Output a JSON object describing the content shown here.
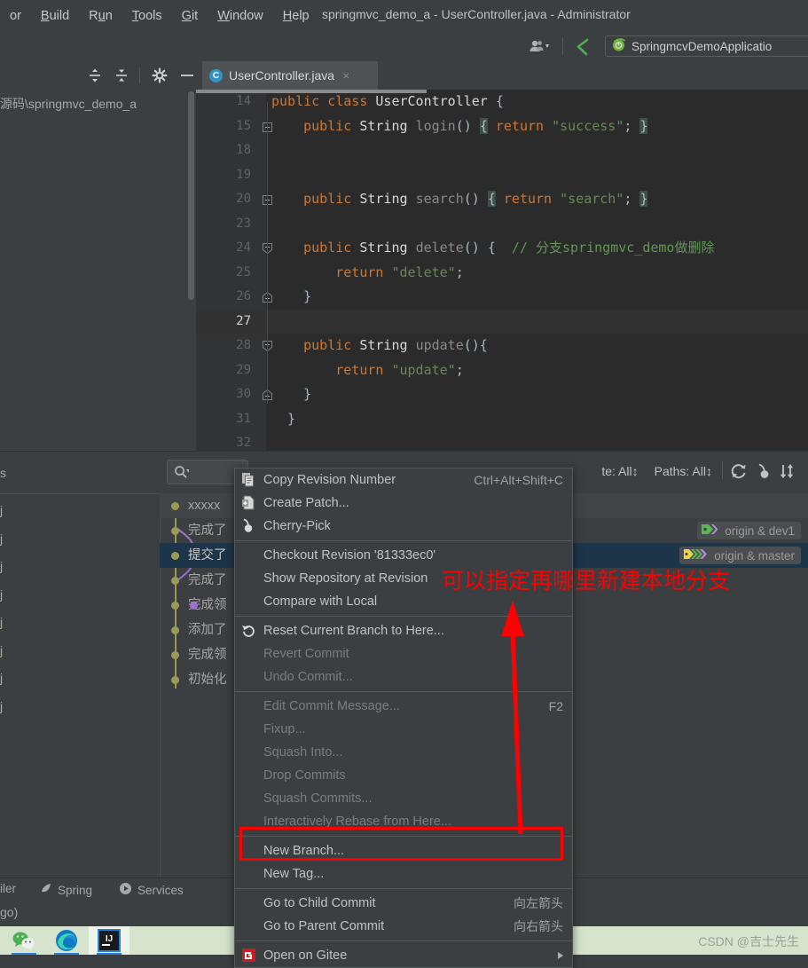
{
  "window": {
    "title": "springmvc_demo_a - UserController.java - Administrator"
  },
  "menubar": {
    "items": [
      {
        "label": "or",
        "mnemonic": ""
      },
      {
        "label": "Build",
        "mnemonic": "B"
      },
      {
        "label": "Run",
        "mnemonic": "u"
      },
      {
        "label": "Tools",
        "mnemonic": "T"
      },
      {
        "label": "Git",
        "mnemonic": "G"
      },
      {
        "label": "Window",
        "mnemonic": "W"
      },
      {
        "label": "Help",
        "mnemonic": "H"
      }
    ]
  },
  "toolbar": {
    "user_icon": "user-icon",
    "back_icon": "back-arrow-icon",
    "run_config": "SpringmcvDemoApplicatio",
    "run_config_icon": "spring-boot-icon"
  },
  "tabstrip": {
    "icons": [
      "expand-all-icon",
      "collapse-all-icon",
      "settings-gear-icon",
      "hide-icon"
    ],
    "tab": {
      "label": "UserController.java",
      "class_marker": "C",
      "close": "×"
    }
  },
  "project_panel": {
    "path": "源码\\springmvc_demo_a"
  },
  "editor": {
    "lines": [
      {
        "num": "14",
        "current": false,
        "fold": "none",
        "tokens": [
          {
            "t": "public ",
            "c": "k-kw"
          },
          {
            "t": "class ",
            "c": "k-kw"
          },
          {
            "t": "UserController ",
            "c": "k-type"
          },
          {
            "t": "{",
            "c": "k-pl"
          }
        ]
      },
      {
        "num": "15",
        "current": false,
        "fold": "plus",
        "tokens": [
          {
            "t": "    ",
            "c": "k-pl"
          },
          {
            "t": "public ",
            "c": "k-kw"
          },
          {
            "t": "String ",
            "c": "k-type"
          },
          {
            "t": "login",
            "c": "k-m"
          },
          {
            "t": "() ",
            "c": "k-pl"
          },
          {
            "t": "{",
            "c": "brmatch"
          },
          {
            "t": " ",
            "c": "k-pl"
          },
          {
            "t": "return ",
            "c": "k-kw"
          },
          {
            "t": "\"success\"",
            "c": "k-str"
          },
          {
            "t": "; ",
            "c": "k-pl"
          },
          {
            "t": "}",
            "c": "brmatch"
          }
        ]
      },
      {
        "num": "18",
        "current": false,
        "fold": "none",
        "tokens": []
      },
      {
        "num": "19",
        "current": false,
        "fold": "none",
        "tokens": []
      },
      {
        "num": "20",
        "current": false,
        "fold": "plus",
        "tokens": [
          {
            "t": "    ",
            "c": "k-pl"
          },
          {
            "t": "public ",
            "c": "k-kw"
          },
          {
            "t": "String ",
            "c": "k-type"
          },
          {
            "t": "search",
            "c": "k-m"
          },
          {
            "t": "() ",
            "c": "k-pl"
          },
          {
            "t": "{",
            "c": "brmatch"
          },
          {
            "t": " ",
            "c": "k-pl"
          },
          {
            "t": "return ",
            "c": "k-kw"
          },
          {
            "t": "\"search\"",
            "c": "k-str"
          },
          {
            "t": "; ",
            "c": "k-pl"
          },
          {
            "t": "}",
            "c": "brmatch"
          }
        ]
      },
      {
        "num": "23",
        "current": false,
        "fold": "none",
        "tokens": []
      },
      {
        "num": "24",
        "current": false,
        "fold": "open",
        "tokens": [
          {
            "t": "    ",
            "c": "k-pl"
          },
          {
            "t": "public ",
            "c": "k-kw"
          },
          {
            "t": "String ",
            "c": "k-type"
          },
          {
            "t": "delete",
            "c": "k-m"
          },
          {
            "t": "() { ",
            "c": "k-pl"
          },
          {
            "t": " // 分支springmvc_demo做删除",
            "c": "k-cm"
          }
        ]
      },
      {
        "num": "25",
        "current": false,
        "fold": "none",
        "tokens": [
          {
            "t": "        ",
            "c": "k-pl"
          },
          {
            "t": "return ",
            "c": "k-kw"
          },
          {
            "t": "\"delete\"",
            "c": "k-str"
          },
          {
            "t": ";",
            "c": "k-pl"
          }
        ]
      },
      {
        "num": "26",
        "current": false,
        "fold": "close",
        "tokens": [
          {
            "t": "    }",
            "c": "k-pl"
          }
        ]
      },
      {
        "num": "27",
        "current": true,
        "fold": "none",
        "tokens": []
      },
      {
        "num": "28",
        "current": false,
        "fold": "open",
        "tokens": [
          {
            "t": "    ",
            "c": "k-pl"
          },
          {
            "t": "public ",
            "c": "k-kw"
          },
          {
            "t": "String ",
            "c": "k-type"
          },
          {
            "t": "update",
            "c": "k-m"
          },
          {
            "t": "(){",
            "c": "k-pl"
          }
        ]
      },
      {
        "num": "29",
        "current": false,
        "fold": "none",
        "tokens": [
          {
            "t": "        ",
            "c": "k-pl"
          },
          {
            "t": "return ",
            "c": "k-kw"
          },
          {
            "t": "\"update\"",
            "c": "k-str"
          },
          {
            "t": ";",
            "c": "k-pl"
          }
        ]
      },
      {
        "num": "30",
        "current": false,
        "fold": "close",
        "tokens": [
          {
            "t": "    }",
            "c": "k-pl"
          }
        ]
      },
      {
        "num": "31",
        "current": false,
        "fold": "none",
        "tokens": [
          {
            "t": "  }",
            "c": "k-pl"
          }
        ]
      },
      {
        "num": "32",
        "current": false,
        "fold": "none",
        "tokens": []
      }
    ]
  },
  "vcs": {
    "left_header": "s",
    "file_rows": [
      "j",
      "j",
      "j",
      "j",
      "j",
      "j",
      "j",
      "j"
    ],
    "toolbar": {
      "search_placeholder": "",
      "search_icon": "search-icon",
      "filters": "te: All",
      "filters2": "Paths: All",
      "icons": [
        "refresh-icon",
        "cherry-pick-icon",
        "sort-icon",
        "more-icon"
      ]
    },
    "commits": [
      {
        "message": "xxxxx",
        "selected": false,
        "alt": true,
        "branches": []
      },
      {
        "message": "完成了",
        "selected": false,
        "alt": false,
        "branches": [
          {
            "label": "origin & dev1",
            "icon": "branch-tag-green"
          }
        ]
      },
      {
        "message": "提交了",
        "selected": true,
        "alt": false,
        "branches": [
          {
            "label": "origin & master",
            "icon": "branch-tag-yellow-green"
          }
        ]
      },
      {
        "message": "完成了",
        "selected": false,
        "alt": false,
        "branches": []
      },
      {
        "message": "完成领",
        "selected": false,
        "alt": false,
        "branches": []
      },
      {
        "message": "添加了",
        "selected": false,
        "alt": false,
        "branches": []
      },
      {
        "message": "完成领",
        "selected": false,
        "alt": false,
        "branches": []
      },
      {
        "message": "初始化",
        "selected": false,
        "alt": false,
        "branches": []
      }
    ]
  },
  "context_menu": {
    "groups": [
      {
        "items": [
          {
            "label": "Copy Revision Number",
            "accel": "Ctrl+Alt+Shift+C",
            "icon": "copy-icon",
            "disabled": false,
            "submenu": false
          },
          {
            "label": "Create Patch...",
            "accel": "",
            "icon": "patch-icon",
            "disabled": false,
            "submenu": false
          },
          {
            "label": "Cherry-Pick",
            "accel": "",
            "icon": "cherry-pick-icon",
            "disabled": false,
            "submenu": false
          }
        ]
      },
      {
        "items": [
          {
            "label": "Checkout Revision '81333ec0'",
            "accel": "",
            "icon": "",
            "disabled": false,
            "submenu": false
          },
          {
            "label": "Show Repository at Revision",
            "accel": "",
            "icon": "",
            "disabled": false,
            "submenu": false
          },
          {
            "label": "Compare with Local",
            "accel": "",
            "icon": "",
            "disabled": false,
            "submenu": false
          }
        ]
      },
      {
        "items": [
          {
            "label": "Reset Current Branch to Here...",
            "accel": "",
            "icon": "reset-icon",
            "disabled": false,
            "submenu": false
          },
          {
            "label": "Revert Commit",
            "accel": "",
            "icon": "",
            "disabled": true,
            "submenu": false
          },
          {
            "label": "Undo Commit...",
            "accel": "",
            "icon": "",
            "disabled": true,
            "submenu": false
          }
        ]
      },
      {
        "items": [
          {
            "label": "Edit Commit Message...",
            "accel": "F2",
            "icon": "",
            "disabled": true,
            "submenu": false
          },
          {
            "label": "Fixup...",
            "accel": "",
            "icon": "",
            "disabled": true,
            "submenu": false
          },
          {
            "label": "Squash Into...",
            "accel": "",
            "icon": "",
            "disabled": true,
            "submenu": false
          },
          {
            "label": "Drop Commits",
            "accel": "",
            "icon": "",
            "disabled": true,
            "submenu": false
          },
          {
            "label": "Squash Commits...",
            "accel": "",
            "icon": "",
            "disabled": true,
            "submenu": false
          },
          {
            "label": "Interactively Rebase from Here...",
            "accel": "",
            "icon": "",
            "disabled": true,
            "submenu": false
          }
        ]
      },
      {
        "items": [
          {
            "label": "New Branch...",
            "accel": "",
            "icon": "",
            "disabled": false,
            "submenu": false,
            "highlighted": true
          },
          {
            "label": "New Tag...",
            "accel": "",
            "icon": "",
            "disabled": false,
            "submenu": false
          }
        ]
      },
      {
        "items": [
          {
            "label": "Go to Child Commit",
            "accel": "向左箭头",
            "icon": "",
            "disabled": false,
            "submenu": false
          },
          {
            "label": "Go to Parent Commit",
            "accel": "向右箭头",
            "icon": "",
            "disabled": false,
            "submenu": false
          }
        ]
      },
      {
        "items": [
          {
            "label": "Open on Gitee",
            "accel": "",
            "icon": "gitee-icon",
            "disabled": false,
            "submenu": true
          }
        ]
      }
    ]
  },
  "status_bar": {
    "items": [
      {
        "label": "iler",
        "icon": ""
      },
      {
        "label": "Spring",
        "icon": "spring-leaf-icon"
      },
      {
        "label": "Services",
        "icon": "services-play-icon"
      }
    ]
  },
  "info_bar": {
    "text": "go)"
  },
  "taskbar": {
    "apps": [
      {
        "name": "wechat-icon",
        "active": false
      },
      {
        "name": "edge-icon",
        "active": false
      },
      {
        "name": "intellij-idea-icon",
        "active": true
      }
    ]
  },
  "annotations": {
    "note_text": "可以指定再哪里新建本地分支",
    "color": "#ff0000"
  },
  "watermark": {
    "text": "CSDN @吉士先生"
  }
}
